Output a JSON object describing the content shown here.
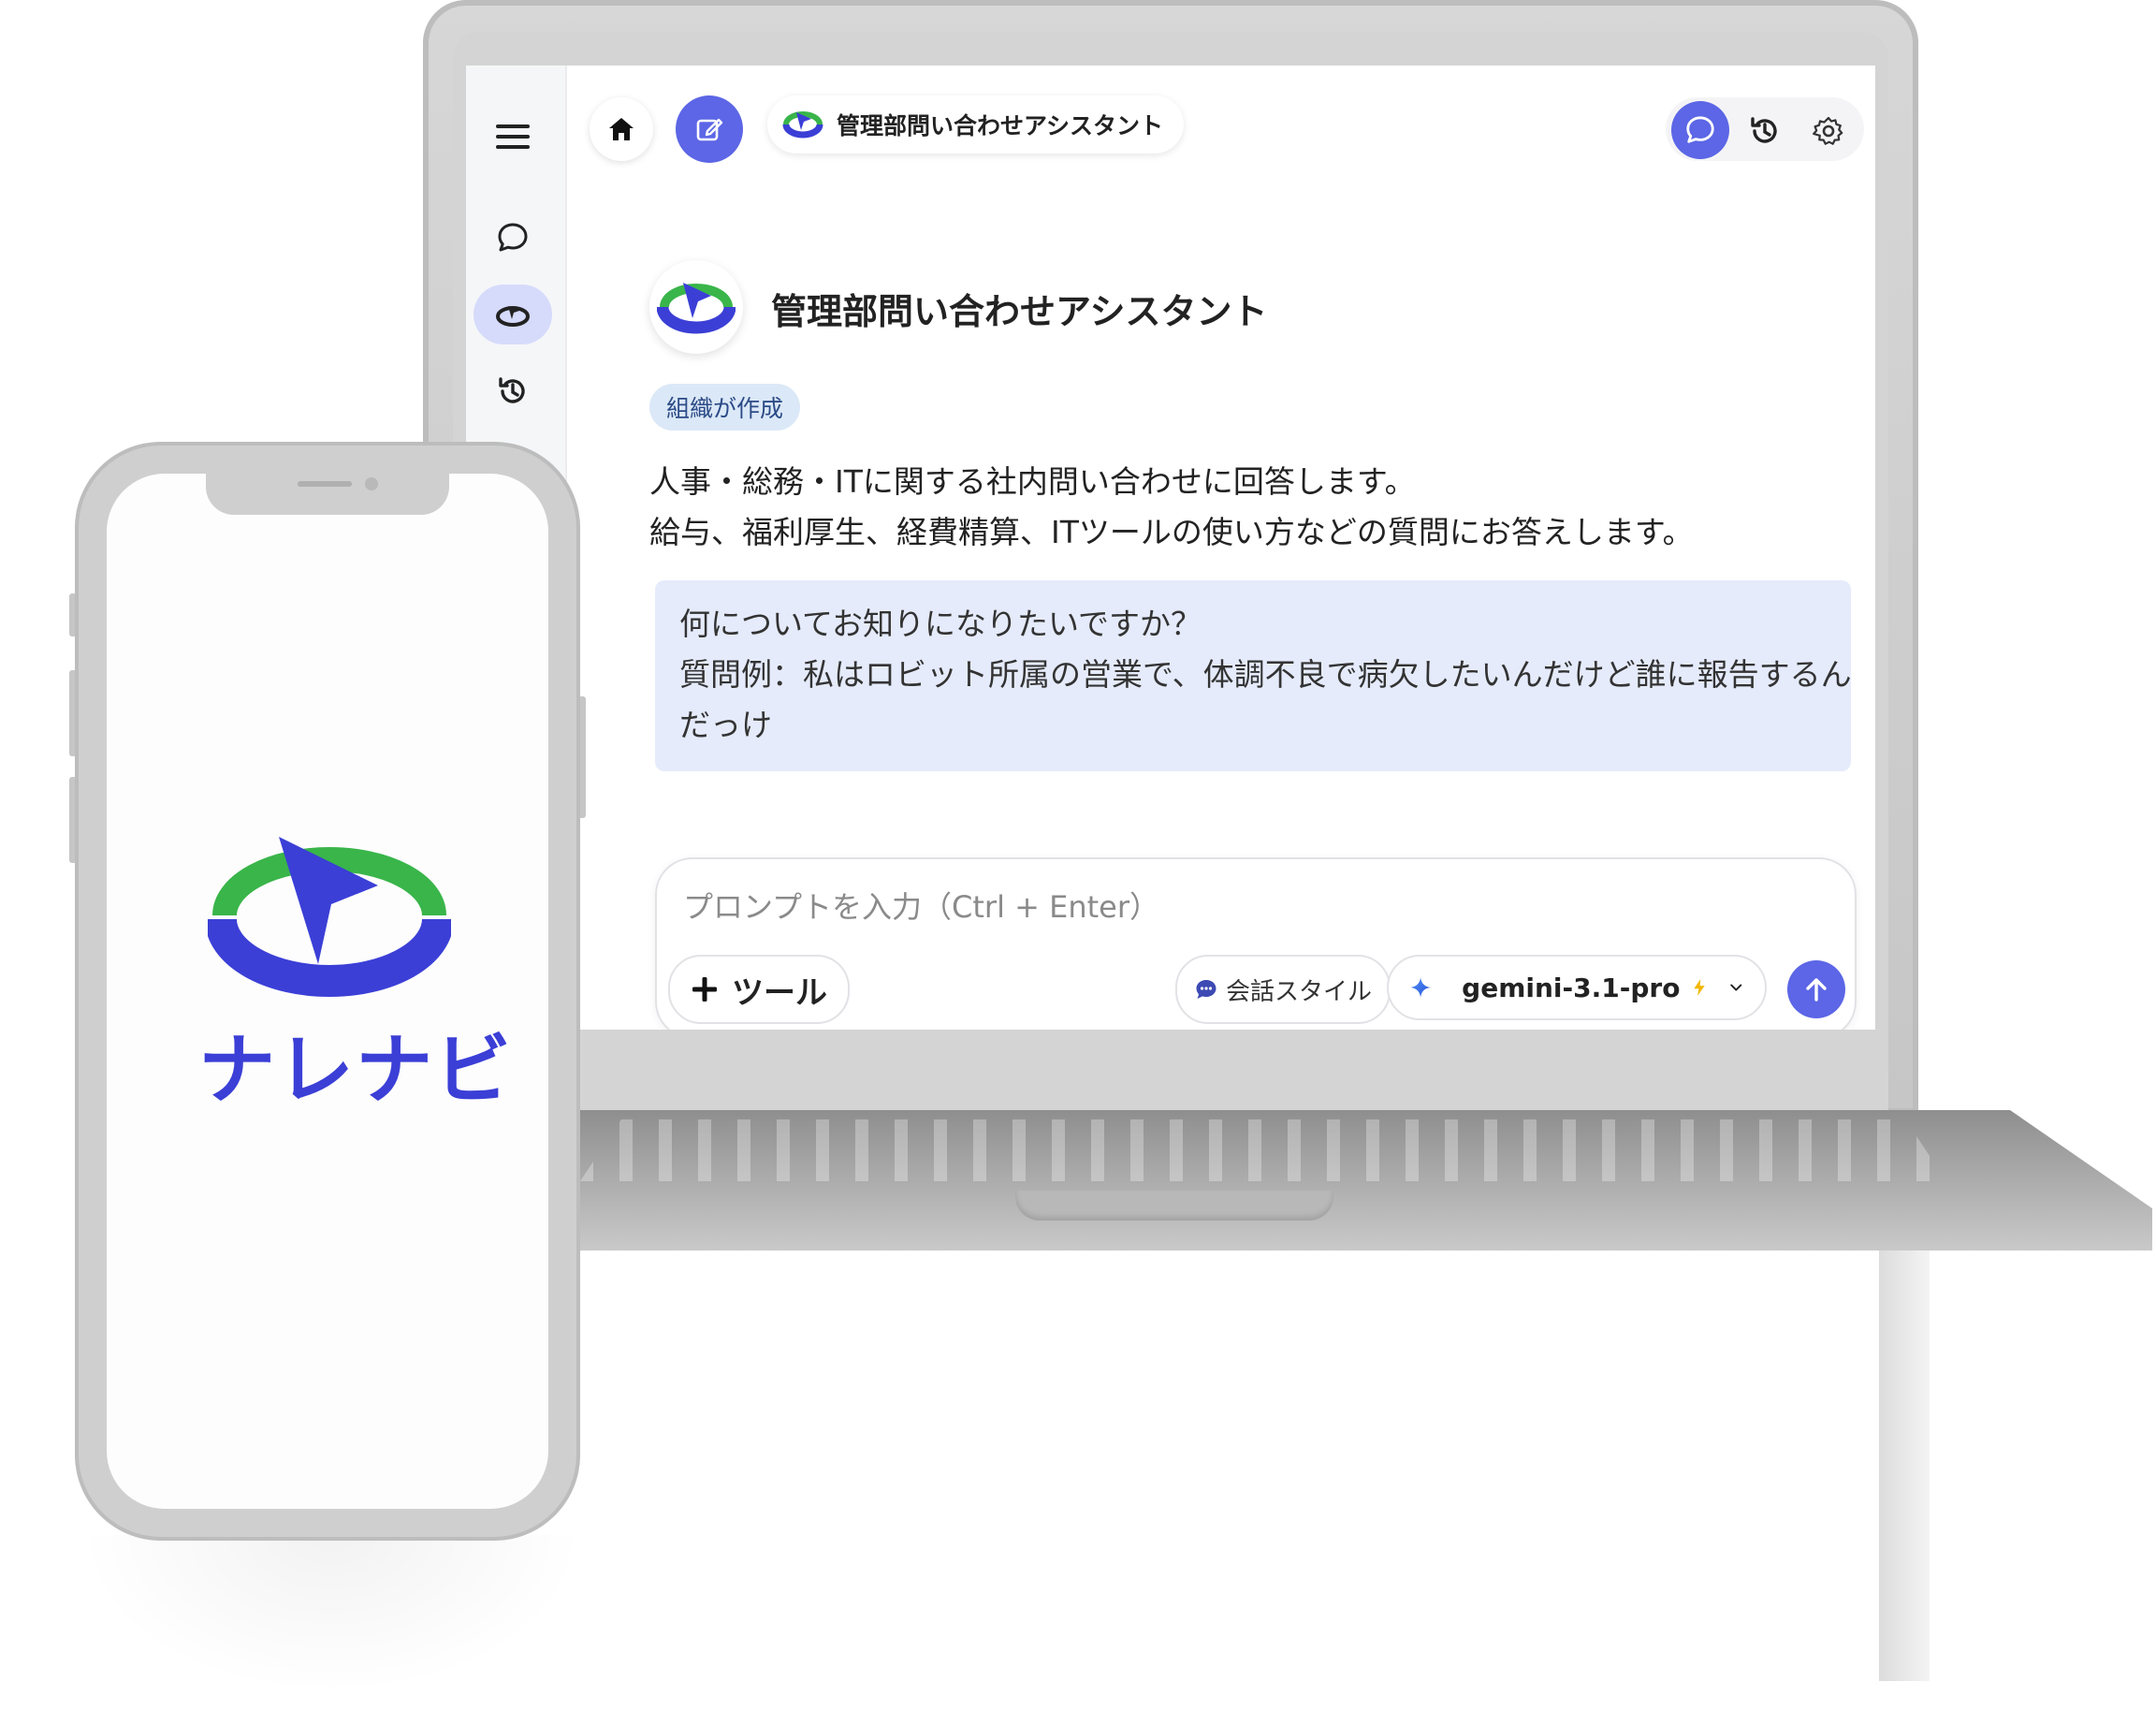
{
  "colors": {
    "accent": "#5c66e6",
    "logo_green": "#39b54a",
    "logo_blue": "#3b3fd6",
    "example_bg": "#e5ebfb",
    "badge_bg": "#dbe8f7"
  },
  "sidebar": {
    "items": [
      {
        "icon": "menu-icon"
      },
      {
        "icon": "chat-bubble-icon"
      },
      {
        "icon": "agent-logo-icon",
        "active": true
      },
      {
        "icon": "history-icon"
      }
    ]
  },
  "topbar": {
    "home_icon": "home-icon",
    "new_chat_icon": "edit-icon",
    "agent_title": "管理部問い合わせアシスタント",
    "right": {
      "chat_icon": "chat-bubble-icon",
      "history_icon": "history-icon",
      "settings_icon": "gear-icon"
    }
  },
  "agent": {
    "name": "管理部問い合わせアシスタント",
    "badge": "組織が作成",
    "description": [
      "人事・総務・ITに関する社内問い合わせに回答します。",
      "給与、福利厚生、経費精算、ITツールの使い方などの質問にお答えします。"
    ],
    "example": [
      "何についてお知りになりたいですか？",
      "質問例：私はロビット所属の営業で、体調不良で病欠したいんだけど誰に報告するん",
      "だっけ"
    ]
  },
  "composer": {
    "placeholder": "プロンプトを入力（Ctrl + Enter）",
    "value": "",
    "tools_label": "ツール",
    "style_label": "会話スタイル",
    "model": "gemini-3.1-pro",
    "send_icon": "arrow-up-icon"
  },
  "phone": {
    "brand": "ナレナビ"
  }
}
